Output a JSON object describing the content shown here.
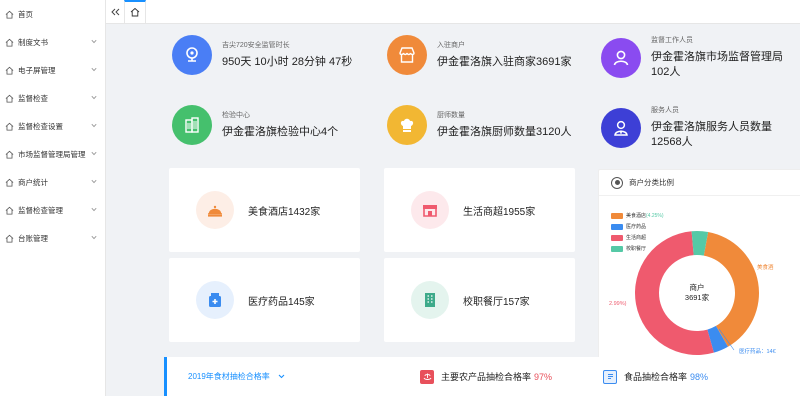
{
  "sidebar": {
    "items": [
      {
        "label": "首页",
        "icon": "home-icon",
        "expandable": false
      },
      {
        "label": "制度文书",
        "icon": "home-icon",
        "expandable": true
      },
      {
        "label": "电子屏管理",
        "icon": "home-icon",
        "expandable": true
      },
      {
        "label": "监督检查",
        "icon": "home-icon",
        "expandable": true
      },
      {
        "label": "监督检查设置",
        "icon": "home-icon",
        "expandable": true
      },
      {
        "label": "市场监督管理局管理",
        "icon": "home-icon",
        "expandable": true
      },
      {
        "label": "商户统计",
        "icon": "home-icon",
        "expandable": true
      },
      {
        "label": "监督检查管理",
        "icon": "home-icon",
        "expandable": true
      },
      {
        "label": "台账管理",
        "icon": "home-icon",
        "expandable": true
      }
    ]
  },
  "tabs": {
    "collapse_icon": "double-chevron-left-icon",
    "home_icon": "home-icon"
  },
  "stats": [
    {
      "label": "吉尖720安全监管时长",
      "value": "950天 10小时 28分钟 47秒",
      "color": "#4a7ef5",
      "icon": "camera-icon"
    },
    {
      "label": "入驻商户",
      "value": "伊金霍洛旗入驻商家3691家",
      "color": "#f08a3a",
      "icon": "shop-icon"
    },
    {
      "label": "监督工作人员",
      "value": "伊金霍洛旗市场监督管理局102人",
      "color": "#8a4bf0",
      "icon": "person-icon"
    },
    {
      "label": "检验中心",
      "value": "伊金霍洛旗检验中心4个",
      "color": "#45c06d",
      "icon": "building-icon"
    },
    {
      "label": "厨师数量",
      "value": "伊金霍洛旗厨师数量3120人",
      "color": "#f2b733",
      "icon": "chef-hat-icon"
    },
    {
      "label": "服务人员",
      "value": "伊金霍洛旗服务人员数量12568人",
      "color": "#3d3fd6",
      "icon": "staff-icon"
    }
  ],
  "cards": [
    {
      "label": "美食酒店1432家",
      "icon": "dish-cover-icon",
      "color": "#f08a3a",
      "bg": "#fdeee6"
    },
    {
      "label": "生活商超1955家",
      "icon": "store-icon",
      "color": "#ef5a6e",
      "bg": "#fde9ec"
    },
    {
      "label": "医疗药品145家",
      "icon": "medicine-icon",
      "color": "#3b8cf0",
      "bg": "#e6f0fd"
    },
    {
      "label": "校职餐厅157家",
      "icon": "canteen-icon",
      "color": "#3daa8a",
      "bg": "#e4f4ee"
    }
  ],
  "pie": {
    "title": "商户分类比例",
    "center_line1": "商户",
    "center_line2": "3691家",
    "legend": [
      {
        "name": "美食酒店",
        "color": "#f08a3a"
      },
      {
        "name": "医疗药品",
        "color": "#3b8cf0"
      },
      {
        "name": "生活商超",
        "color": "#ef5a6e"
      },
      {
        "name": "校职餐厅",
        "color": "#55c9a6"
      }
    ],
    "legend_pct": "(4.25%)",
    "outer_labels": {
      "food": "美食酒",
      "medical": "医疗药品：14€",
      "left_pct": "2.99%)"
    }
  },
  "chart_data": {
    "type": "pie",
    "title": "商户分类比例",
    "categories": [
      "美食酒店",
      "医疗药品",
      "生活商超",
      "校职餐厅"
    ],
    "values": [
      1432,
      145,
      1955,
      157
    ]
  },
  "bottom": {
    "select_label": "2019年食材抽检合格率",
    "rate1_label": "主要农产品抽检合格率",
    "rate1_value": "97%",
    "rate1_color": "#e8505b",
    "rate2_label": "食品抽检合格率",
    "rate2_value": "98%",
    "rate2_color": "#3b8cf0"
  }
}
